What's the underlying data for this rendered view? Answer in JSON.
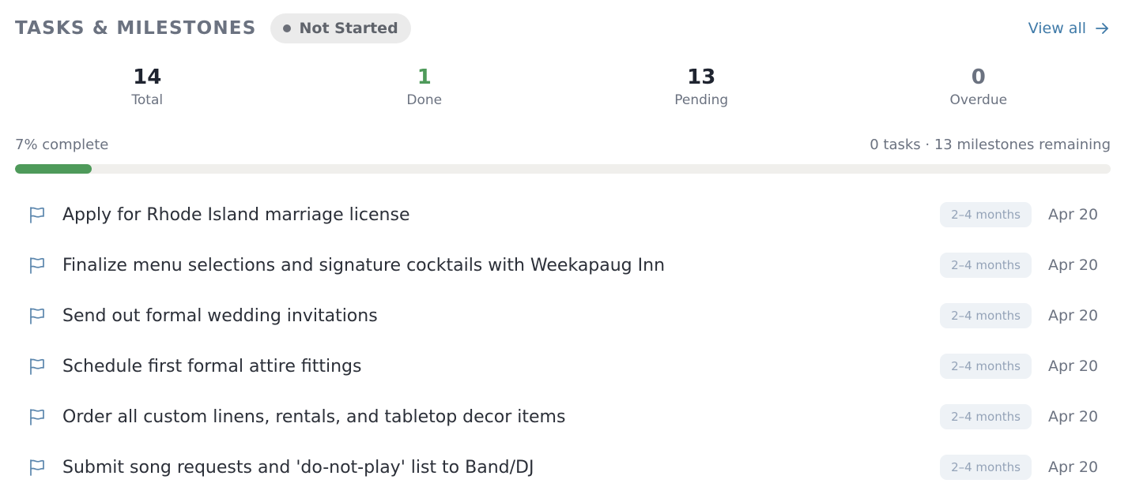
{
  "header": {
    "title": "TASKS & MILESTONES",
    "status": "Not Started",
    "view_all": "View all"
  },
  "stats": [
    {
      "value": "14",
      "label": "Total"
    },
    {
      "value": "1",
      "label": "Done"
    },
    {
      "value": "13",
      "label": "Pending"
    },
    {
      "value": "0",
      "label": "Overdue"
    }
  ],
  "progress": {
    "label": "7% complete",
    "remaining": "0 tasks · 13 milestones remaining",
    "percent": 7
  },
  "items": [
    {
      "title": "Apply for Rhode Island marriage license",
      "duration": "2–4 months",
      "date": "Apr 20"
    },
    {
      "title": "Finalize menu selections and signature cocktails with Weekapaug Inn",
      "duration": "2–4 months",
      "date": "Apr 20"
    },
    {
      "title": "Send out formal wedding invitations",
      "duration": "2–4 months",
      "date": "Apr 20"
    },
    {
      "title": "Schedule first formal attire fittings",
      "duration": "2–4 months",
      "date": "Apr 20"
    },
    {
      "title": "Order all custom linens, rentals, and tabletop decor items",
      "duration": "2–4 months",
      "date": "Apr 20"
    },
    {
      "title": "Submit song requests and 'do-not-play' list to Band/DJ",
      "duration": "2–4 months",
      "date": "Apr 20"
    }
  ],
  "icons": {
    "item": "flag-icon",
    "view_all": "arrow-right-icon",
    "status": "dot-icon"
  },
  "colors": {
    "accent_link": "#3f7aa8",
    "done": "#4e9a5a",
    "progress_fill": "#4e9a5a",
    "badge_bg": "#eef2f6"
  }
}
